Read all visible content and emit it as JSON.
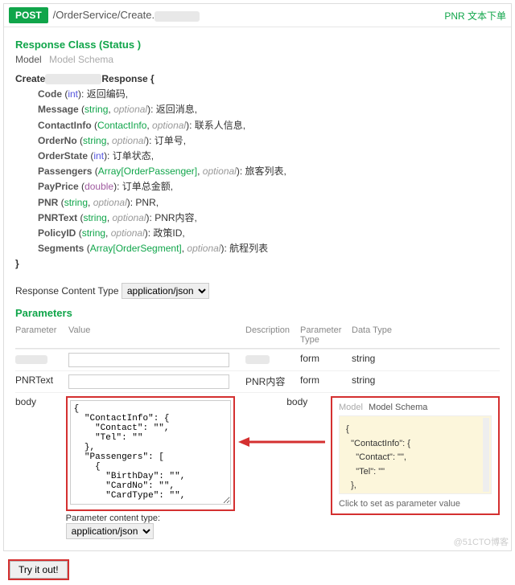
{
  "op": {
    "method": "POST",
    "path_prefix": "/OrderService/Create.",
    "summary": "PNR 文本下单"
  },
  "response": {
    "heading": "Response Class (Status )",
    "tabs": {
      "model": "Model",
      "schema": "Model Schema"
    },
    "sig_prefix": "Create",
    "sig_suffix": "Response {",
    "close": "}",
    "fields": [
      {
        "name": "Code",
        "type": "int",
        "type_kind": "int",
        "optional": false,
        "desc": "返回编码,"
      },
      {
        "name": "Message",
        "type": "string",
        "type_kind": "str",
        "optional": true,
        "desc": "返回消息,"
      },
      {
        "name": "ContactInfo",
        "type": "ContactInfo",
        "type_kind": "str",
        "optional": true,
        "desc": "联系人信息,"
      },
      {
        "name": "OrderNo",
        "type": "string",
        "type_kind": "str",
        "optional": true,
        "desc": "订单号,"
      },
      {
        "name": "OrderState",
        "type": "int",
        "type_kind": "int",
        "optional": false,
        "desc": "订单状态,"
      },
      {
        "name": "Passengers",
        "type": "Array[OrderPassenger]",
        "type_kind": "arr",
        "optional": true,
        "desc": "旅客列表,"
      },
      {
        "name": "PayPrice",
        "type": "double",
        "type_kind": "dbl",
        "optional": false,
        "desc": "订单总金额,"
      },
      {
        "name": "PNR",
        "type": "string",
        "type_kind": "str",
        "optional": true,
        "desc": "PNR,"
      },
      {
        "name": "PNRText",
        "type": "string",
        "type_kind": "str",
        "optional": true,
        "desc": "PNR内容,"
      },
      {
        "name": "PolicyID",
        "type": "string",
        "type_kind": "str",
        "optional": true,
        "desc": "政策ID,"
      },
      {
        "name": "Segments",
        "type": "Array[OrderSegment]",
        "type_kind": "arr",
        "optional": true,
        "desc": "航程列表"
      }
    ]
  },
  "content_type": {
    "label": "Response Content Type",
    "options": [
      "application/json"
    ],
    "value": "application/json"
  },
  "params": {
    "heading": "Parameters",
    "columns": {
      "p": "Parameter",
      "v": "Value",
      "d": "Description",
      "t": "Parameter Type",
      "dt": "Data Type"
    },
    "rows": [
      {
        "name": "",
        "value": "",
        "desc": "",
        "ptype": "form",
        "dtype": "string",
        "name_hidden": true,
        "desc_hidden": true
      },
      {
        "name": "PNRText",
        "value": "",
        "desc": "PNR内容",
        "ptype": "form",
        "dtype": "string"
      }
    ],
    "body_row": {
      "name": "body",
      "ptype": "body",
      "value": "{\n  \"ContactInfo\": {\n    \"Contact\": \"\",\n    \"Tel\": \"\"\n  },\n  \"Passengers\": [\n    {\n      \"BirthDay\": \"\",\n      \"CardNo\": \"\",\n      \"CardType\": \"\",",
      "pct_label": "Parameter content type:",
      "pct_value": "application/json",
      "schema_tabs": {
        "model": "Model",
        "schema": "Model Schema"
      },
      "schema_text": "{\n  \"ContactInfo\": {\n    \"Contact\": \"\",\n    \"Tel\": \"\"\n  },",
      "schema_hint": "Click to set as parameter value"
    }
  },
  "try_label": "Try it out!",
  "watermark": "@51CTO博客"
}
